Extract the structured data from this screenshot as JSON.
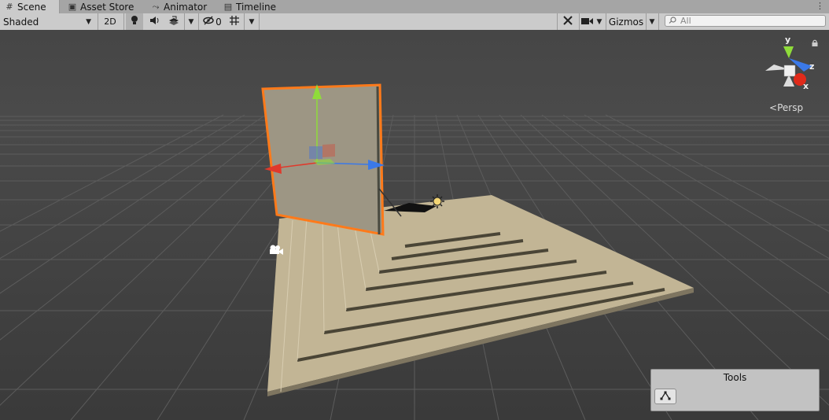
{
  "tabs": [
    {
      "label": "Scene",
      "icon": "grid-icon",
      "active": true
    },
    {
      "label": "Asset Store",
      "icon": "bag-icon",
      "active": false
    },
    {
      "label": "Animator",
      "icon": "animator-icon",
      "active": false
    },
    {
      "label": "Timeline",
      "icon": "film-icon",
      "active": false
    }
  ],
  "toolbar": {
    "draw_mode": "Shaded",
    "btn_2d": "2D",
    "hidden_count": "0",
    "gizmos_label": "Gizmos",
    "search_placeholder": "All"
  },
  "gizmo": {
    "y_label": "y",
    "z_label": "z",
    "x_label": "x",
    "persp_label": "Persp"
  },
  "tools_overlay": {
    "title": "Tools"
  },
  "colors": {
    "selection_outline": "#ff7a1a",
    "axis_x": "#e0392b",
    "axis_y": "#8fdc3a",
    "axis_z": "#3b79e8",
    "ground": "#bdb08f",
    "panel": "#9d9684"
  }
}
